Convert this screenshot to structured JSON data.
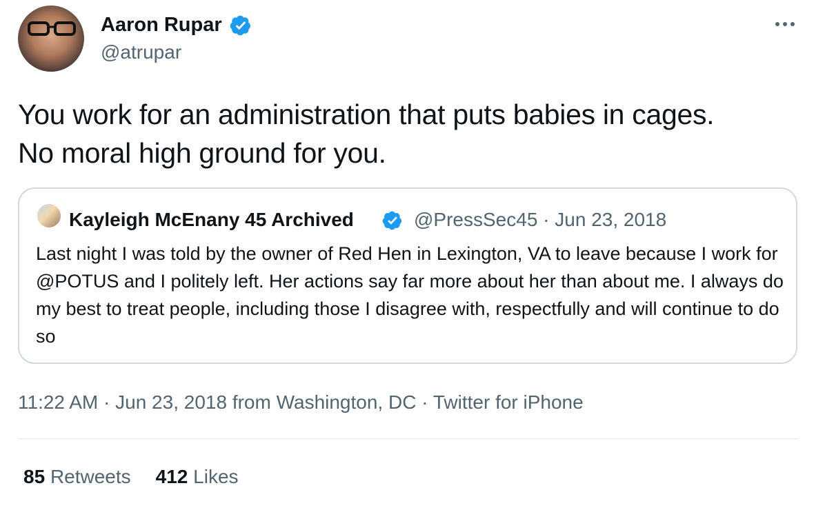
{
  "author": {
    "name": "Aaron Rupar",
    "handle": "@atrupar",
    "verified": true
  },
  "tweet_text": "You work for an administration that puts babies in cages.\nNo moral high ground for you.",
  "quoted_tweet": {
    "name": "Kayleigh McEnany 45 Archived",
    "verified": true,
    "meta": "@PressSec45 · Jun 23, 2018",
    "text": "Last night I was told by the owner of Red Hen in Lexington, VA to leave because I work for @POTUS and I politely left. Her actions say far more about her than about me. I always do my best to treat people, including those I disagree with, respectfully and will continue to do so"
  },
  "timestamp": {
    "time": "11:22 AM",
    "separator1": " · ",
    "date": "Jun 23, 2018",
    "location": " from Washington, DC",
    "separator2": " · ",
    "client": "Twitter for iPhone"
  },
  "stats": {
    "retweets_count": "85",
    "retweets_label": "Retweets",
    "likes_count": "412",
    "likes_label": "Likes"
  },
  "colors": {
    "verified_blue": "#1d9bf0",
    "secondary_text": "#536471",
    "border": "#cfd9de"
  },
  "icons": {
    "verified": "verified-badge-icon",
    "more": "more-horizontal-icon"
  }
}
